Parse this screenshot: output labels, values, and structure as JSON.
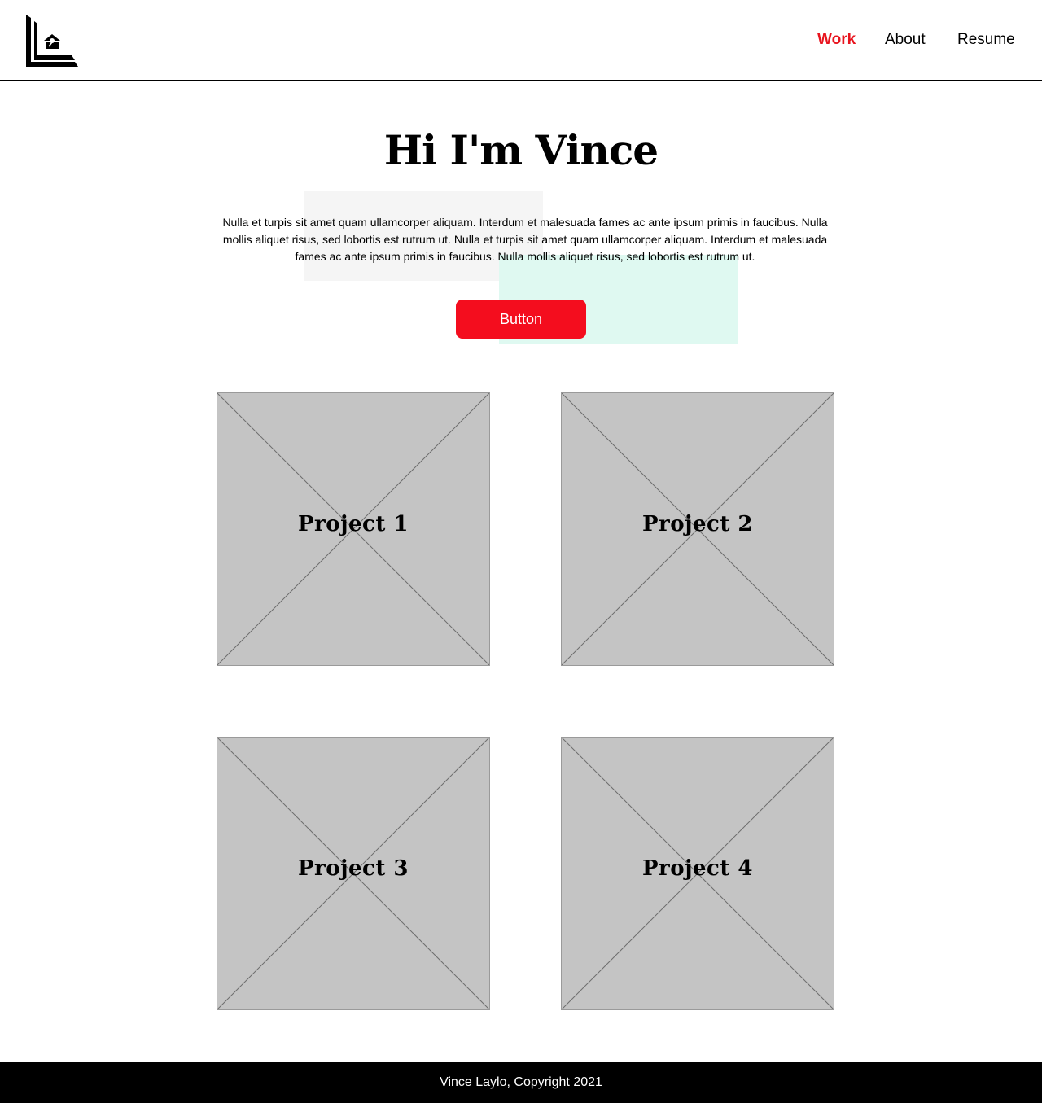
{
  "brand": {
    "logo_icon": "vl-monogram-icon"
  },
  "nav": {
    "items": [
      {
        "label": "Work",
        "active": true
      },
      {
        "label": "About",
        "active": false
      },
      {
        "label": "Resume",
        "active": false
      }
    ]
  },
  "hero": {
    "title": "Hi I'm Vince",
    "intro": "Nulla et turpis sit amet quam ullamcorper aliquam. Interdum et malesuada fames ac ante ipsum primis in faucibus. Nulla mollis aliquet risus, sed lobortis est rutrum ut. Nulla et turpis sit amet quam ullamcorper aliquam. Interdum et malesuada fames ac ante ipsum primis in faucibus. Nulla mollis aliquet risus, sed lobortis est rutrum ut.",
    "button_label": "Button"
  },
  "projects": [
    {
      "label": "Project 1"
    },
    {
      "label": "Project 2"
    },
    {
      "label": "Project 3"
    },
    {
      "label": "Project 4"
    }
  ],
  "footer": {
    "text": "Vince Laylo, Copyright 2021"
  },
  "colors": {
    "accent": "#f40d1e",
    "placeholder": "#c4c4c4",
    "footer_bg": "#000000"
  }
}
